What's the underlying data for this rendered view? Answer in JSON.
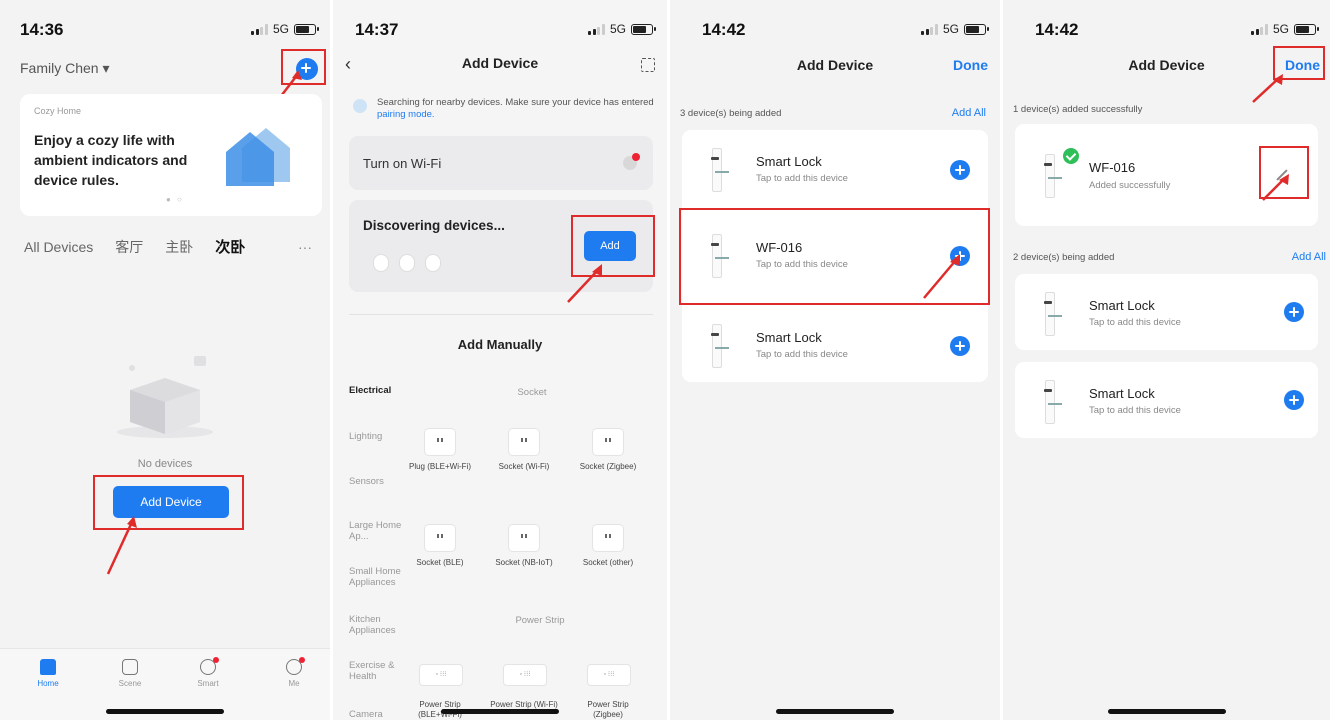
{
  "status": {
    "p1": {
      "time": "14:36",
      "net": "5G"
    },
    "p2": {
      "time": "14:37",
      "net": "5G"
    },
    "p3": {
      "time": "14:42",
      "net": "5G"
    },
    "p4": {
      "time": "14:42",
      "net": "5G"
    }
  },
  "home": {
    "family": "Family Chen ▾",
    "banner_tag": "Cozy Home",
    "banner_text": "Enjoy a cozy life with ambient indicators and device rules.",
    "tabs": [
      "All Devices",
      "客厅",
      "主卧",
      "次卧",
      "···"
    ],
    "empty_text": "No devices",
    "add_device_button": "Add Device",
    "tabbar": [
      "Home",
      "Scene",
      "Smart",
      "Me"
    ]
  },
  "add_device": {
    "title": "Add Device",
    "search_text": "Searching for nearby devices. Make sure your device has entered",
    "search_link": "pairing mode.",
    "wifi_label": "Turn on Wi-Fi",
    "discovering": "Discovering devices...",
    "add_button": "Add",
    "manual_title": "Add Manually",
    "categories": [
      "Electrical",
      "Lighting",
      "Sensors",
      "Large Home Ap...",
      "Small Home Appliances",
      "Kitchen Appliances",
      "Exercise & Health",
      "Camera"
    ],
    "socket_header": "Socket",
    "power_strip_header": "Power Strip",
    "devices_row1": [
      "Plug (BLE+Wi-Fi)",
      "Socket (Wi-Fi)",
      "Socket (Zigbee)"
    ],
    "devices_row2": [
      "Socket (BLE)",
      "Socket (NB-IoT)",
      "Socket (other)"
    ],
    "strips": [
      "Power Strip (BLE+Wi-Fi)",
      "Power Strip (Wi-Fi)",
      "Power Strip (Zigbee)"
    ]
  },
  "adding": {
    "title": "Add Device",
    "done": "Done",
    "section": "3 device(s) being added",
    "add_all": "Add All",
    "devices": [
      {
        "name": "Smart Lock",
        "sub": "Tap to add this device"
      },
      {
        "name": "WF-016",
        "sub": "Tap to add this device"
      },
      {
        "name": "Smart Lock",
        "sub": "Tap to add this device"
      }
    ]
  },
  "added": {
    "title": "Add Device",
    "done": "Done",
    "success_section": "1 device(s) added successfully",
    "success_device": {
      "name": "WF-016",
      "sub": "Added successfully"
    },
    "pending_section": "2 device(s) being added",
    "add_all": "Add All",
    "pending": [
      {
        "name": "Smart Lock",
        "sub": "Tap to add this device"
      },
      {
        "name": "Smart Lock",
        "sub": "Tap to add this device"
      }
    ]
  },
  "colors": {
    "accent": "#1e7cf0",
    "highlight": "#e02b2b",
    "success": "#2fbf58"
  }
}
